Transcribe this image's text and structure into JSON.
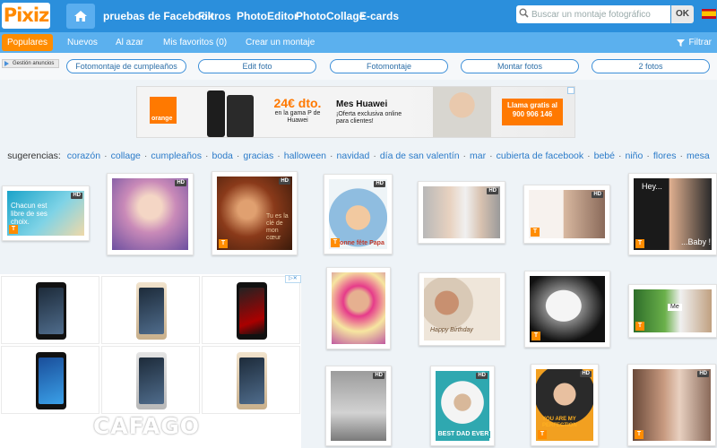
{
  "header": {
    "logo": "Pixiz",
    "nav": [
      "pruebas de Facebook",
      "Filtros",
      "PhotoEditor",
      "PhotoCollage",
      "E-cards"
    ],
    "search_placeholder": "Buscar un montaje fotográfico",
    "search_button": "OK"
  },
  "subnav": {
    "items": [
      "Populares",
      "Nuevos",
      "Al azar",
      "Mis favoritos (0)",
      "Crear un montaje"
    ],
    "filter": "Filtrar"
  },
  "ad_tag": "Gestión anuncios",
  "pills": [
    "Fotomontaje de cumpleaños",
    "Edit foto",
    "Fotomontaje",
    "Montar fotos",
    "2 fotos"
  ],
  "banner": {
    "brand": "orange",
    "discount": "24€ dto.",
    "discount_sub": "en la gama P de Huawei",
    "title": "Mes Huawei",
    "desc": "¡Oferta exclusiva online para clientes!",
    "cta": "Llama gratis al 900 906 146"
  },
  "suggestions": {
    "label": "sugerencias:",
    "tags": [
      "corazón",
      "collage",
      "cumpleaños",
      "boda",
      "gracias",
      "halloween",
      "navidad",
      "día de san valentín",
      "mar",
      "cubierta de facebook",
      "bebé",
      "niño",
      "flores",
      "mesa"
    ]
  },
  "thumbs": {
    "hd": "HD",
    "t": "T",
    "captions": {
      "sea": "Chacun est libre de ses choix.",
      "key": "Tu es la clé de mon cœur",
      "dad": "Bonne fête Papa",
      "hey": "Hey...",
      "baby": "...Baby !",
      "birthday": "Happy Birthday",
      "me": "Me",
      "bestdad": "BEST DAD EVER",
      "perfection": "YOU ARE MY PERFECTION"
    }
  },
  "phone_ad": {
    "brand": "CAFAGO"
  },
  "colors": {
    "topbar": "#2b8fdc",
    "subbar": "#5bb0ee",
    "accent": "#ff8c00",
    "link": "#2b7bc9"
  }
}
